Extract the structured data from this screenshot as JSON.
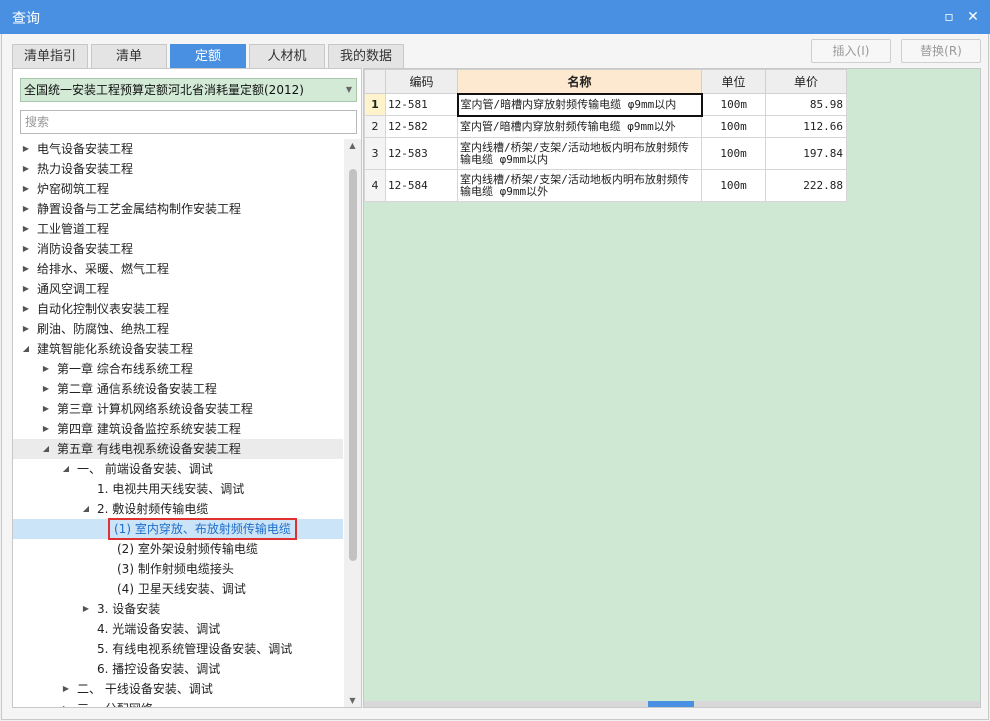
{
  "window": {
    "title": "查询",
    "maximize_glyph": "▫",
    "close_glyph": "✕"
  },
  "tabs": [
    {
      "label": "清单指引"
    },
    {
      "label": "清单"
    },
    {
      "label": "定额"
    },
    {
      "label": "人材机"
    },
    {
      "label": "我的数据"
    }
  ],
  "active_tab": 2,
  "toolbar": {
    "insert_label": "插入(I)",
    "replace_label": "替换(R)"
  },
  "left": {
    "quota_book": "全国统一安装工程预算定额河北省消耗量定额(2012)",
    "search_placeholder": "搜索",
    "tree": [
      {
        "label": "电气设备安装工程",
        "level": 0,
        "state": "collapsed"
      },
      {
        "label": "热力设备安装工程",
        "level": 0,
        "state": "collapsed"
      },
      {
        "label": "炉窑砌筑工程",
        "level": 0,
        "state": "collapsed"
      },
      {
        "label": "静置设备与工艺金属结构制作安装工程",
        "level": 0,
        "state": "collapsed"
      },
      {
        "label": "工业管道工程",
        "level": 0,
        "state": "collapsed"
      },
      {
        "label": "消防设备安装工程",
        "level": 0,
        "state": "collapsed"
      },
      {
        "label": "给排水、采暖、燃气工程",
        "level": 0,
        "state": "collapsed"
      },
      {
        "label": "通风空调工程",
        "level": 0,
        "state": "collapsed"
      },
      {
        "label": "自动化控制仪表安装工程",
        "level": 0,
        "state": "collapsed"
      },
      {
        "label": "刷油、防腐蚀、绝热工程",
        "level": 0,
        "state": "collapsed"
      },
      {
        "label": "建筑智能化系统设备安装工程",
        "level": 0,
        "state": "expanded"
      },
      {
        "label": "第一章 综合布线系统工程",
        "level": 1,
        "state": "collapsed"
      },
      {
        "label": "第二章 通信系统设备安装工程",
        "level": 1,
        "state": "collapsed"
      },
      {
        "label": "第三章 计算机网络系统设备安装工程",
        "level": 1,
        "state": "collapsed"
      },
      {
        "label": "第四章 建筑设备监控系统安装工程",
        "level": 1,
        "state": "collapsed"
      },
      {
        "label": "第五章 有线电视系统设备安装工程",
        "level": 1,
        "state": "expanded",
        "highlight": true
      },
      {
        "label": "一、 前端设备安装、调试",
        "level": 2,
        "state": "expanded"
      },
      {
        "label": "1. 电视共用天线安装、调试",
        "level": 3,
        "state": "leaf"
      },
      {
        "label": "2. 敷设射频传输电缆",
        "level": 3,
        "state": "expanded"
      },
      {
        "label": "(1) 室内穿放、布放射频传输电缆",
        "level": 4,
        "state": "leaf",
        "selected": true
      },
      {
        "label": "(2) 室外架设射频传输电缆",
        "level": 4,
        "state": "leaf"
      },
      {
        "label": "(3) 制作射频电缆接头",
        "level": 4,
        "state": "leaf"
      },
      {
        "label": "(4) 卫星天线安装、调试",
        "level": 4,
        "state": "leaf"
      },
      {
        "label": "3. 设备安装",
        "level": 3,
        "state": "collapsed"
      },
      {
        "label": "4. 光端设备安装、调试",
        "level": 3,
        "state": "leaf"
      },
      {
        "label": "5. 有线电视系统管理设备安装、调试",
        "level": 3,
        "state": "leaf"
      },
      {
        "label": "6. 播控设备安装、调试",
        "level": 3,
        "state": "leaf"
      },
      {
        "label": "二、 干线设备安装、调试",
        "level": 2,
        "state": "collapsed"
      },
      {
        "label": "三、 分配网络",
        "level": 2,
        "state": "collapsed"
      }
    ]
  },
  "grid": {
    "columns": {
      "code": "编码",
      "name": "名称",
      "unit": "单位",
      "price": "单价"
    },
    "rows": [
      {
        "n": "1",
        "code": "12-581",
        "name": "室内管/暗槽内穿放射频传输电缆 φ9mm以内",
        "unit": "100m",
        "price": "85.98"
      },
      {
        "n": "2",
        "code": "12-582",
        "name": "室内管/暗槽内穿放射频传输电缆 φ9mm以外",
        "unit": "100m",
        "price": "112.66"
      },
      {
        "n": "3",
        "code": "12-583",
        "name": "室内线槽/桥架/支架/活动地板内明布放射频传输电缆 φ9mm以内",
        "unit": "100m",
        "price": "197.84"
      },
      {
        "n": "4",
        "code": "12-584",
        "name": "室内线槽/桥架/支架/活动地板内明布放射频传输电缆 φ9mm以外",
        "unit": "100m",
        "price": "222.88"
      }
    ]
  }
}
